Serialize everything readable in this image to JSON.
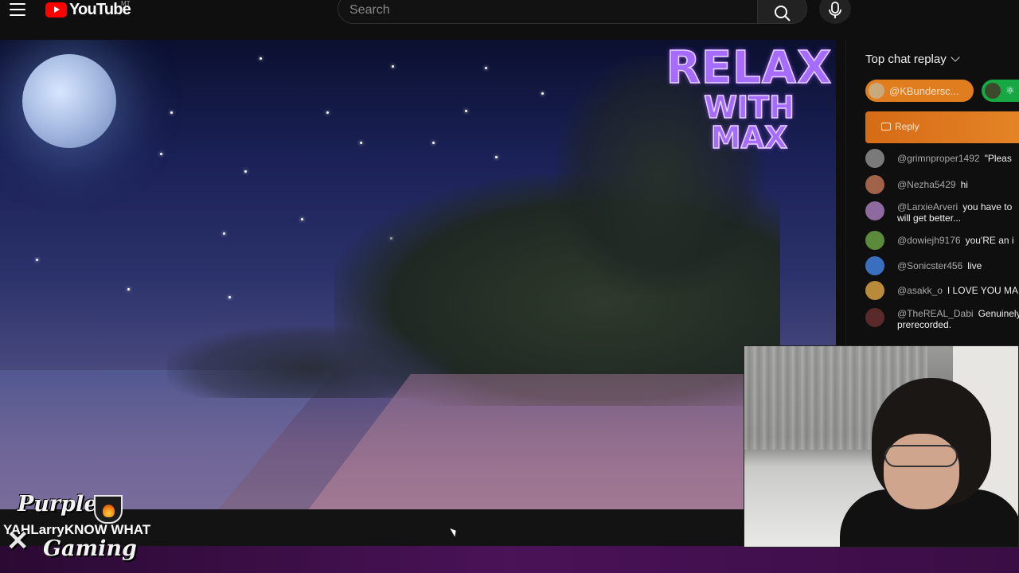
{
  "header": {
    "logo_text": "YouTube",
    "logo_sup": "MT",
    "search_placeholder": "Search"
  },
  "video": {
    "overlay_logo": {
      "line1": "RELAX",
      "line2": "WITH MAX"
    }
  },
  "chat": {
    "header": "Top chat replay",
    "pinned": [
      {
        "author": "@KBundersc..."
      }
    ],
    "reply_label": "Reply",
    "messages": [
      {
        "author": "@grimnproper1492",
        "text": "\"Pleas",
        "avatar_color": "#7a7a7a"
      },
      {
        "author": "@Nezha5429",
        "text": "hi",
        "avatar_color": "#a0634a"
      },
      {
        "author": "@LarxieArveri",
        "text": "you have to",
        "text2": "will get better...",
        "avatar_color": "#8e6aa0"
      },
      {
        "author": "@dowiejh9176",
        "text": "you'RE an i",
        "avatar_color": "#5a8a3a"
      },
      {
        "author": "@Sonicster456",
        "text": "live",
        "avatar_color": "#3a6fc0"
      },
      {
        "author": "@asakk_o",
        "text": "I LOVE YOU MA",
        "avatar_color": "#b98a3a"
      },
      {
        "author": "@TheREAL_Dabi",
        "text": "Genuinely",
        "text2": "prerecorded.",
        "avatar_color": "#5a2a2a"
      }
    ]
  },
  "overlay": {
    "caption": "YAHLarryKNOW WHAT",
    "brand_line1": "Purple",
    "brand_line2": "Gaming"
  },
  "colors": {
    "youtube_red": "#ff0000",
    "pinned_orange": "#e07d1f",
    "pinned_green": "#17a844",
    "relax_purple": "#a66bff"
  }
}
